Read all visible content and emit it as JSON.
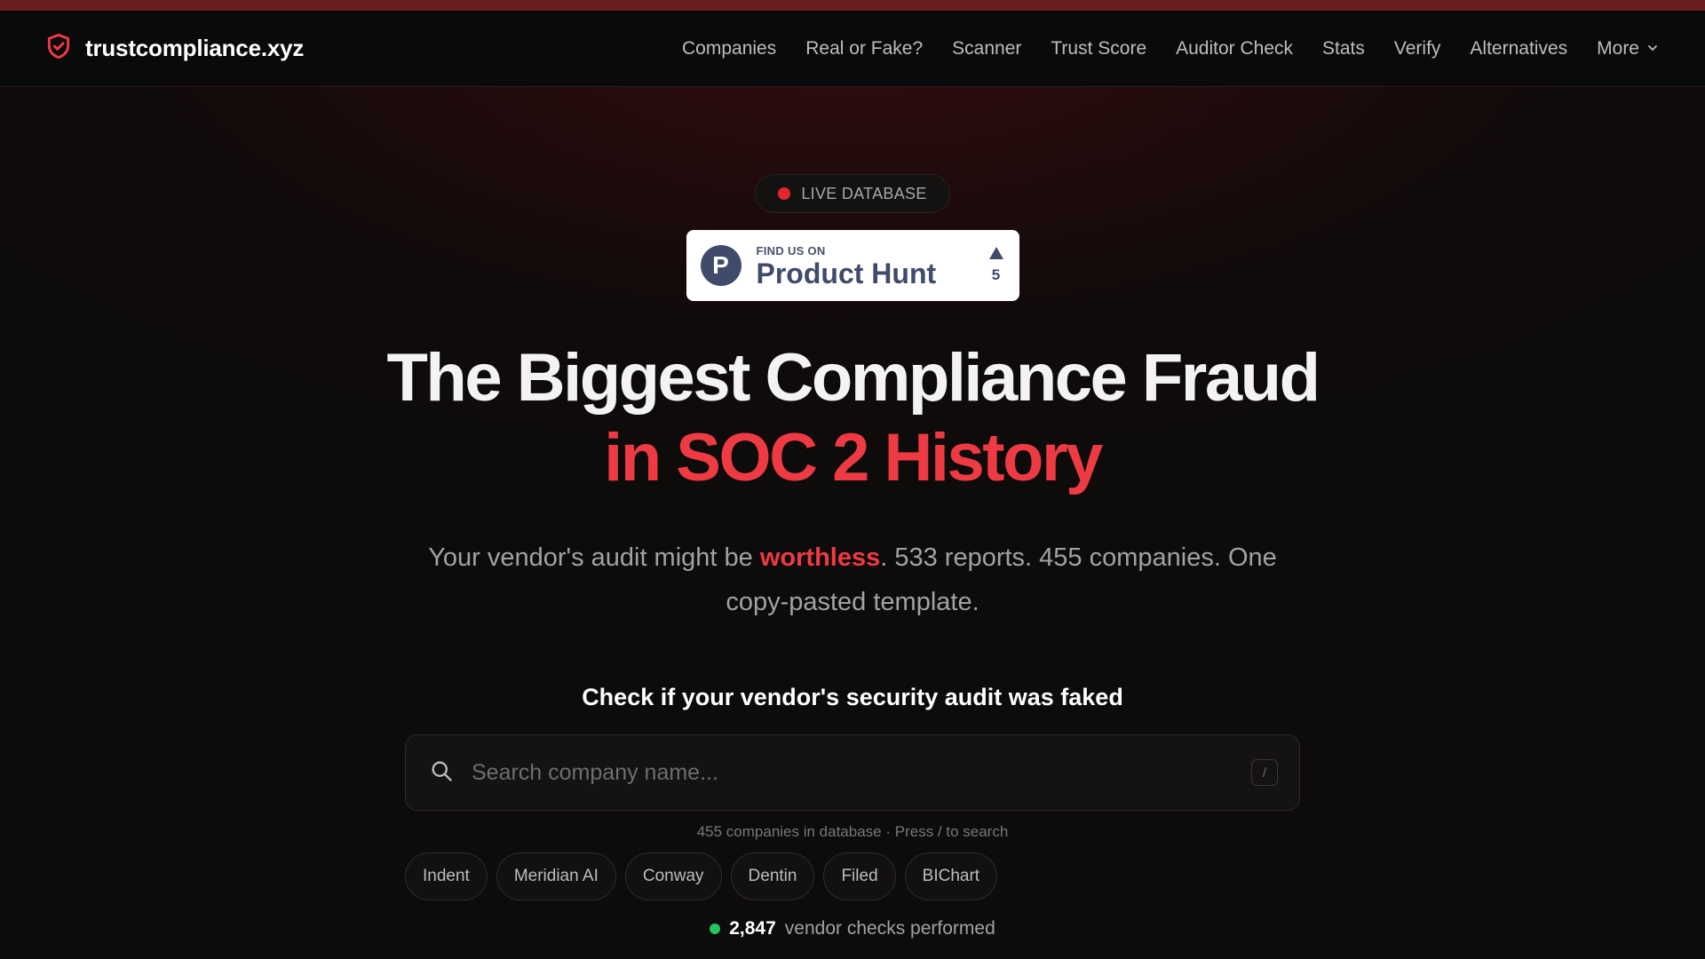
{
  "header": {
    "brand": "trustcompliance.xyz",
    "brand_icon": "shield-check-icon",
    "nav": [
      "Companies",
      "Real or Fake?",
      "Scanner",
      "Trust Score",
      "Auditor Check",
      "Stats",
      "Verify",
      "Alternatives"
    ],
    "more_label": "More"
  },
  "hero": {
    "live_badge": "LIVE DATABASE",
    "product_hunt": {
      "find_us": "FIND US ON",
      "name": "Product Hunt",
      "logo_letter": "P",
      "votes": "5"
    },
    "title_line1": "The Biggest Compliance Fraud",
    "title_line2": "in SOC 2 History",
    "subtitle_pre": "Your vendor's audit might be ",
    "subtitle_highlight": "worthless",
    "subtitle_post": ". 533 reports. 455 companies. One copy-pasted template."
  },
  "search": {
    "heading": "Check if your vendor's security audit was faked",
    "placeholder": "Search company name...",
    "shortcut_key": "/",
    "note": "455 companies in database · Press / to search",
    "suggestions": [
      "Indent",
      "Meridian AI",
      "Conway",
      "Dentin",
      "Filed",
      "BIChart"
    ]
  },
  "stats": {
    "count": "2,847",
    "label": "vendor checks performed"
  },
  "colors": {
    "accent_red": "#ee3b43",
    "live_dot": "#e3262e",
    "status_green": "#22c55e",
    "product_hunt_navy": "#404a6b"
  }
}
